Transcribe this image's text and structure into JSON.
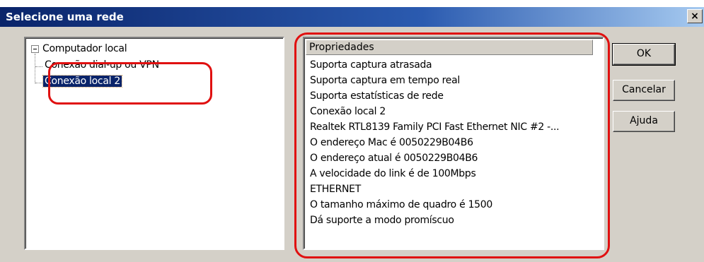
{
  "dialog": {
    "title": "Selecione uma rede",
    "close_label": "×"
  },
  "tree": {
    "root": "Computador local",
    "children": [
      {
        "label": "Conexão dial-up ou VPN",
        "selected": false
      },
      {
        "label": "Conexão local 2",
        "selected": true
      }
    ]
  },
  "properties": {
    "header": "Propriedades",
    "items": [
      "Suporta captura atrasada",
      "Suporta captura em tempo real",
      "Suporta estatísticas de rede",
      "Conexão local 2",
      "Realtek RTL8139 Family PCI Fast Ethernet NIC #2 -...",
      "O endereço Mac é 0050229B04B6",
      "O endereço atual é 0050229B04B6",
      "A velocidade do link é de 100Mbps",
      "ETHERNET",
      "O tamanho máximo de quadro é 1500",
      "Dá suporte a modo promíscuo"
    ]
  },
  "buttons": {
    "ok": "OK",
    "cancel": "Cancelar",
    "help": "Ajuda"
  },
  "colors": {
    "annotation": "#e01010",
    "selection": "#0a246a",
    "titlebar": "#0a246a"
  }
}
